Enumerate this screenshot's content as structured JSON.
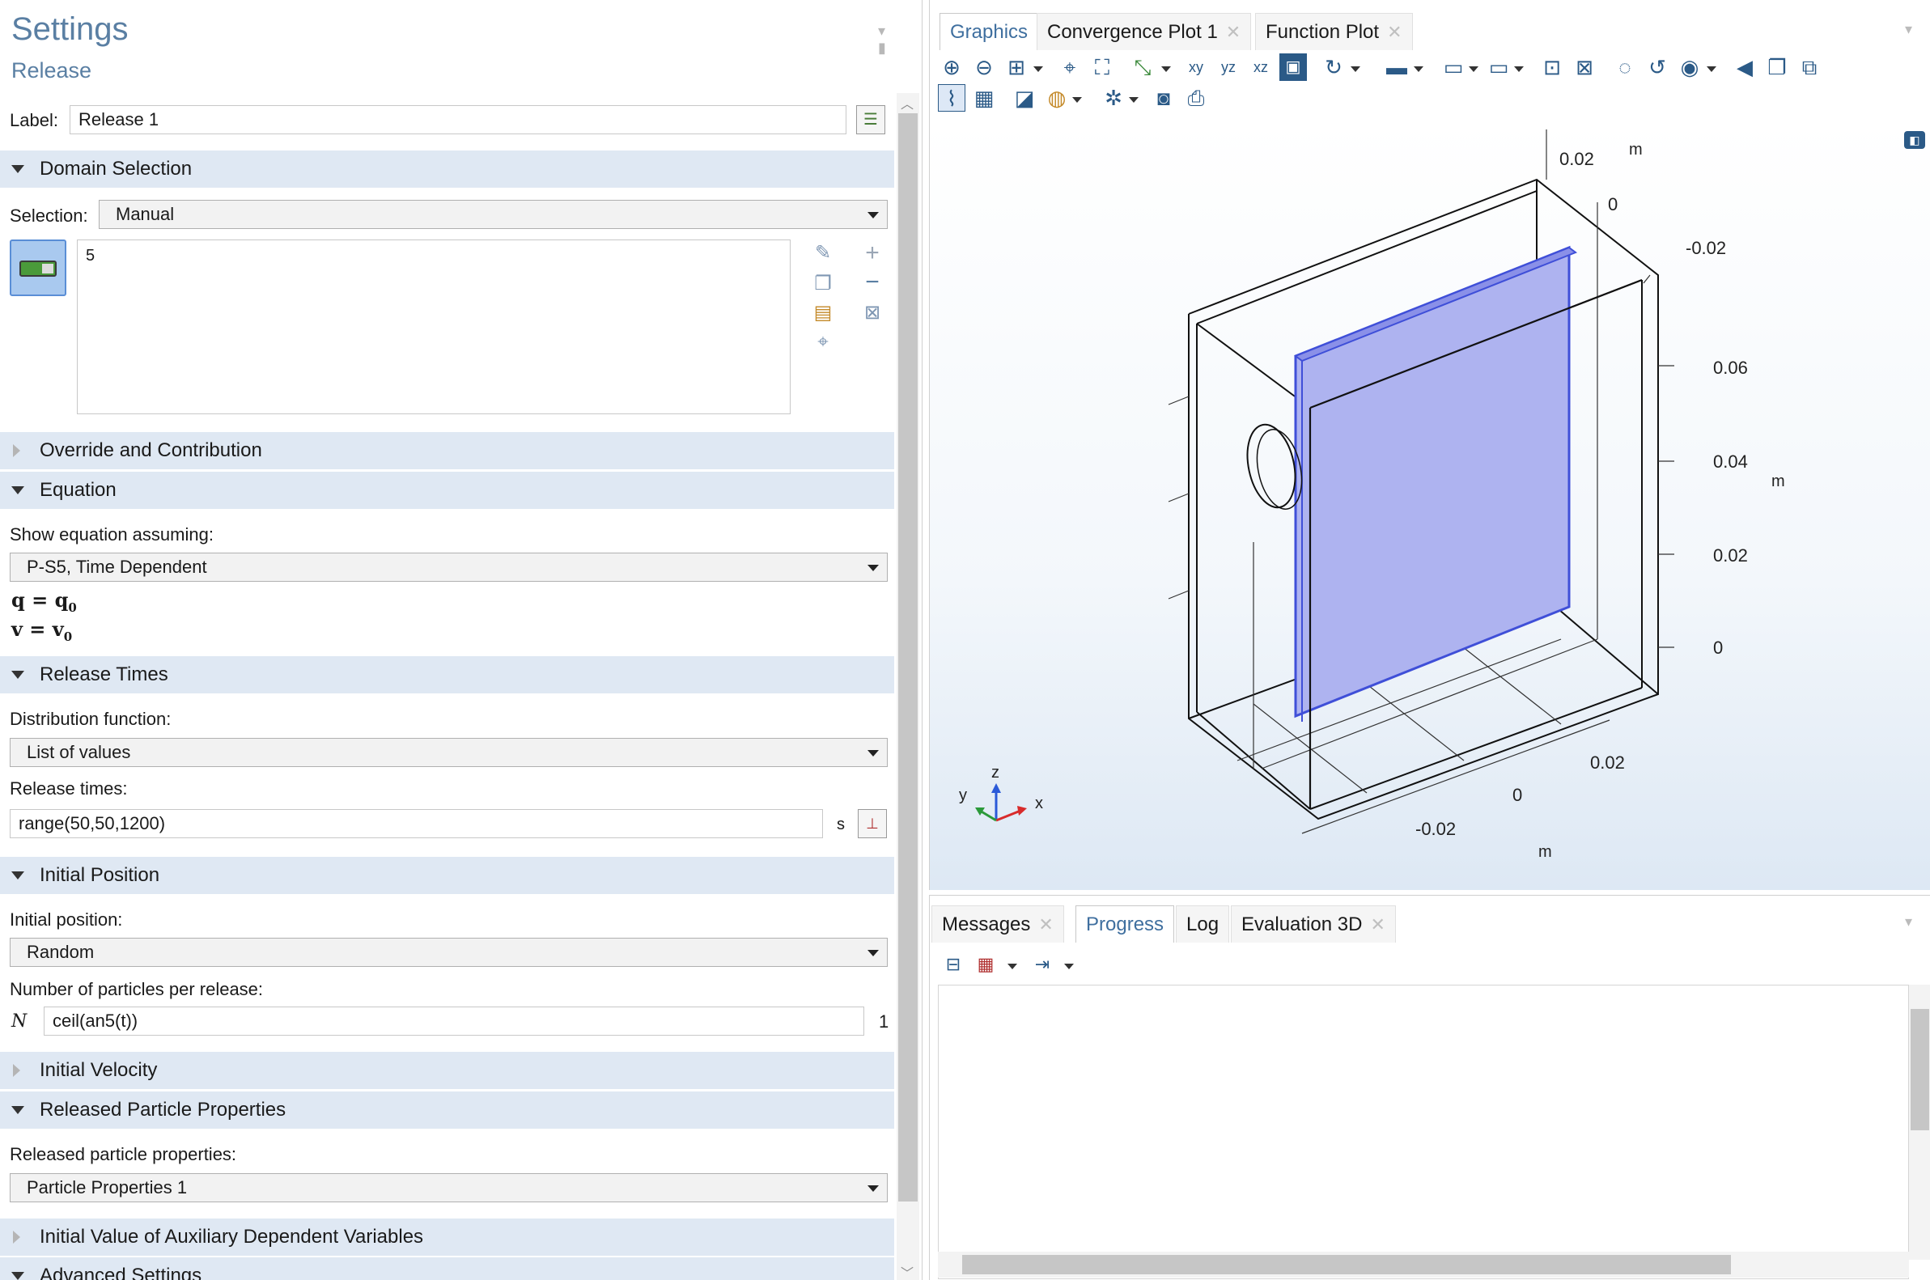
{
  "settings": {
    "title": "Settings",
    "subtitle": "Release",
    "label_caption": "Label:",
    "label_value": "Release 1",
    "domain_selection": {
      "header": "Domain Selection",
      "selection_caption": "Selection:",
      "selection_value": "Manual",
      "selected_items": "5"
    },
    "override_header": "Override and Contribution",
    "equation": {
      "header": "Equation",
      "show_caption": "Show equation assuming:",
      "show_value": "P-S5, Time Dependent",
      "eq1_lhs": "q",
      "eq1_rhs": "q",
      "eq1_sub": "0",
      "eq2_lhs": "v",
      "eq2_rhs": "v",
      "eq2_sub": "0"
    },
    "release_times": {
      "header": "Release Times",
      "dist_caption": "Distribution function:",
      "dist_value": "List of values",
      "times_caption": "Release times:",
      "times_value": "range(50,50,1200)",
      "times_unit": "s"
    },
    "initial_position": {
      "header": "Initial Position",
      "pos_caption": "Initial position:",
      "pos_value": "Random",
      "count_caption": "Number of particles per release:",
      "count_symbol": "N",
      "count_value": "ceil(an5(t))",
      "count_unit": "1"
    },
    "initial_velocity_header": "Initial Velocity",
    "released_props": {
      "header": "Released Particle Properties",
      "caption": "Released particle properties:",
      "value": "Particle Properties 1"
    },
    "aux_header": "Initial Value of Auxiliary Dependent Variables",
    "advanced_header": "Advanced Settings"
  },
  "graphics": {
    "tabs": [
      {
        "label": "Graphics"
      },
      {
        "label": "Convergence Plot 1"
      },
      {
        "label": "Function Plot"
      }
    ],
    "axes": {
      "y_top_02": "0.02",
      "y_top_0": "0",
      "y_top_m02": "-0.02",
      "y_unit_top": "m",
      "z_006": "0.06",
      "z_004": "0.04",
      "z_002": "0.02",
      "z_0": "0",
      "z_unit": "m",
      "x_002": "0.02",
      "x_0": "0",
      "x_m002": "-0.02",
      "x_unit": "m"
    },
    "triad": {
      "z": "z",
      "y": "y",
      "x": "x"
    }
  },
  "messages": {
    "tabs": [
      {
        "label": "Messages"
      },
      {
        "label": "Progress"
      },
      {
        "label": "Log"
      },
      {
        "label": "Evaluation 3D"
      }
    ]
  },
  "colors": {
    "section_bg": "#dfe8f3",
    "title_blue": "#5a7fa3",
    "plate_fill": "#aeb3f0",
    "plate_edge": "#3f4fd8"
  }
}
